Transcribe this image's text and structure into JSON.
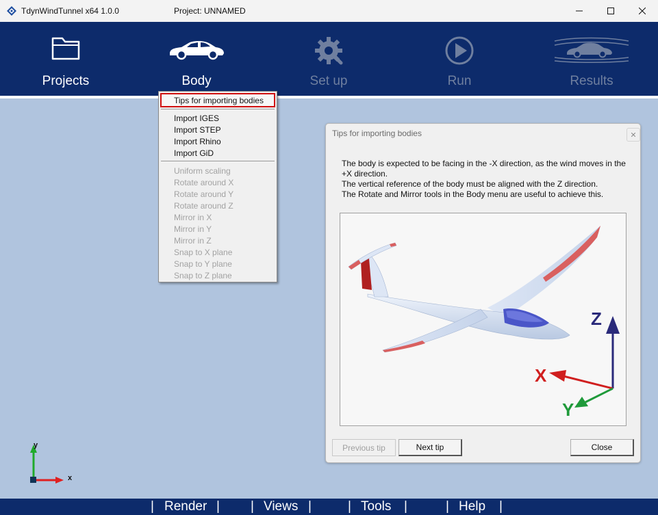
{
  "window": {
    "app_title": "TdynWindTunnel x64 1.0.0",
    "project_title": "Project: UNNAMED"
  },
  "toolbar": {
    "items": [
      {
        "label": "Projects",
        "icon": "folder-icon",
        "enabled": true
      },
      {
        "label": "Body",
        "icon": "car-icon",
        "enabled": true
      },
      {
        "label": "Set up",
        "icon": "gear-wrench-icon",
        "enabled": false
      },
      {
        "label": "Run",
        "icon": "play-icon",
        "enabled": false
      },
      {
        "label": "Results",
        "icon": "car-streamlines-icon",
        "enabled": false
      }
    ]
  },
  "body_menu": {
    "highlighted": "Tips for importing bodies",
    "import_items": [
      "Import IGES",
      "Import STEP",
      "Import Rhino",
      "Import GiD"
    ],
    "transform_items": [
      "Uniform scaling",
      "Rotate around X",
      "Rotate around Y",
      "Rotate around Z",
      "Mirror in X",
      "Mirror in Y",
      "Mirror in Z",
      "Snap to X plane",
      "Snap to Y plane",
      "Snap to Z plane"
    ]
  },
  "dialog": {
    "title": "Tips for importing bodies",
    "text_lines": [
      "The body is expected to be facing in the -X direction, as the wind moves in the",
      "+X direction.",
      "The vertical reference of the body must be aligned with the Z direction.",
      "The Rotate and Mirror tools in the Body menu are useful to achieve this."
    ],
    "axis_labels": {
      "x": "X",
      "y": "Y",
      "z": "Z"
    },
    "buttons": {
      "previous": "Previous tip",
      "next": "Next tip",
      "close": "Close"
    }
  },
  "viewport_axes": {
    "x": "x",
    "y": "y"
  },
  "bottom_menu": {
    "items": [
      "Render",
      "Views",
      "Tools",
      "Help"
    ],
    "separator": "|"
  },
  "colors": {
    "toolbar_bg": "#0d2b6b",
    "viewport_bg": "#b0c4de",
    "highlight_border": "#d01010"
  }
}
